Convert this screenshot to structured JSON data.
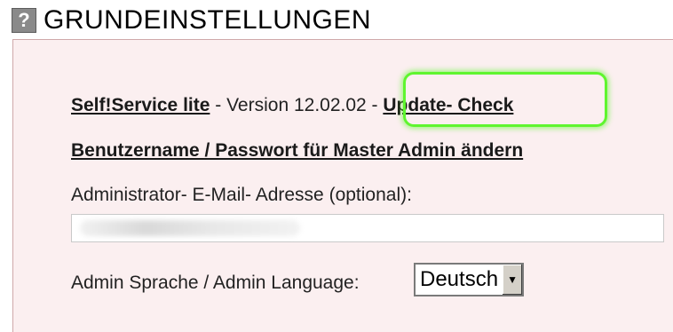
{
  "header": {
    "help_icon_glyph": "?",
    "title": "GRUNDEINSTELLUNGEN"
  },
  "version_line": {
    "product_link": "Self!Service lite",
    "version_text": " - Version 12.02.02 - ",
    "update_link": "Update- Check"
  },
  "credentials_link": "Benutzername / Passwort für Master Admin ändern",
  "email": {
    "label": "Administrator- E-Mail- Adresse (optional):",
    "value": ""
  },
  "language": {
    "label": "Admin Sprache / Admin Language: ",
    "selected": "Deutsch",
    "dropdown_icon": "arrow-down"
  },
  "colors": {
    "panel_background": "#fbeff0",
    "highlight": "#5ff52f"
  }
}
